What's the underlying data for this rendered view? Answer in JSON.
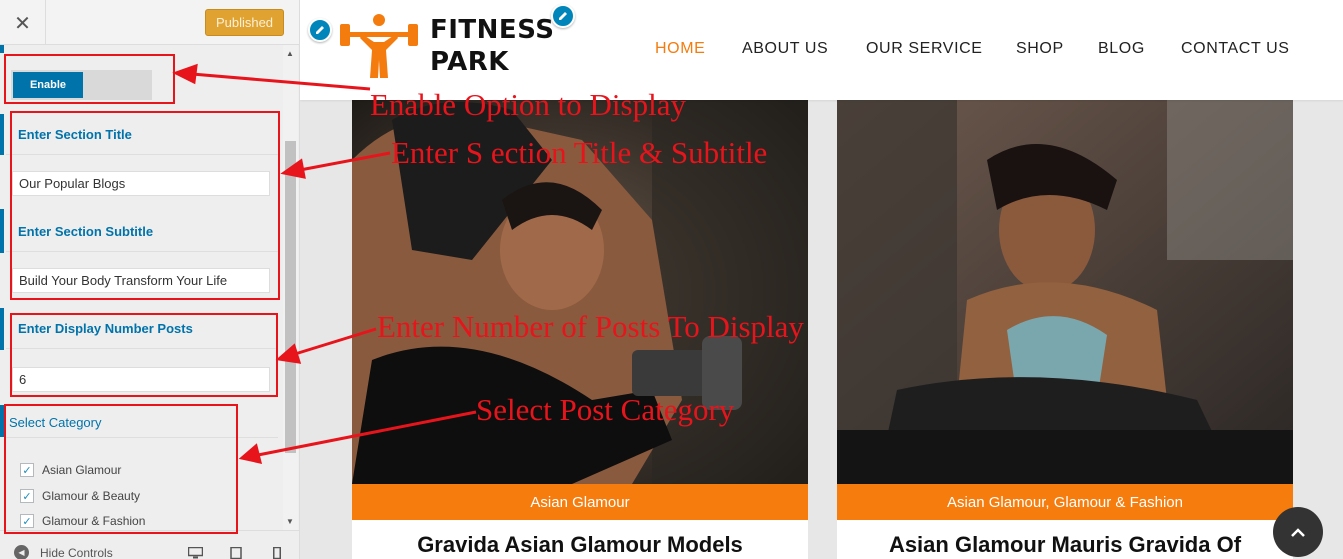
{
  "sidebar": {
    "close_glyph": "✕",
    "published_label": "Published",
    "enable_label": "Enable",
    "section_title_label": "Enter Section Title",
    "section_title_value": "Our Popular Blogs",
    "section_subtitle_label": "Enter Section Subtitle",
    "section_subtitle_value": "Build Your Body Transform Your Life",
    "display_number_label": "Enter Display Number Posts",
    "display_number_value": "6",
    "select_category_label": "Select Category",
    "categories": [
      {
        "label": "Asian Glamour",
        "checked": true
      },
      {
        "label": "Glamour & Beauty",
        "checked": true
      },
      {
        "label": "Glamour & Fashion",
        "checked": true
      }
    ],
    "hide_controls_label": "Hide Controls",
    "device_icons": [
      "desktop-icon",
      "tablet-icon",
      "mobile-icon"
    ]
  },
  "site": {
    "logo_line1": "FITNESS",
    "logo_line2": "PARK",
    "nav": [
      "HOME",
      "ABOUT US",
      "OUR SERVICE",
      "SHOP",
      "BLOG",
      "CONTACT US"
    ],
    "nav_active": "HOME",
    "cards": [
      {
        "category": "Asian Glamour",
        "title": "Gravida Asian Glamour Models"
      },
      {
        "category": "Asian Glamour, Glamour & Fashion",
        "title": "Asian Glamour Mauris Gravida Of"
      }
    ]
  },
  "annotations": {
    "enable": "Enable Option to Display",
    "title_subtitle": "Enter S ection Title & Subtitle",
    "number_posts": "Enter Number of Posts To Display",
    "category": "Select Post Category"
  },
  "colors": {
    "accent_blue": "#0073aa",
    "brand_orange": "#f47c0f",
    "published_gold": "#e0a332",
    "annotation_red": "#e8141c"
  }
}
